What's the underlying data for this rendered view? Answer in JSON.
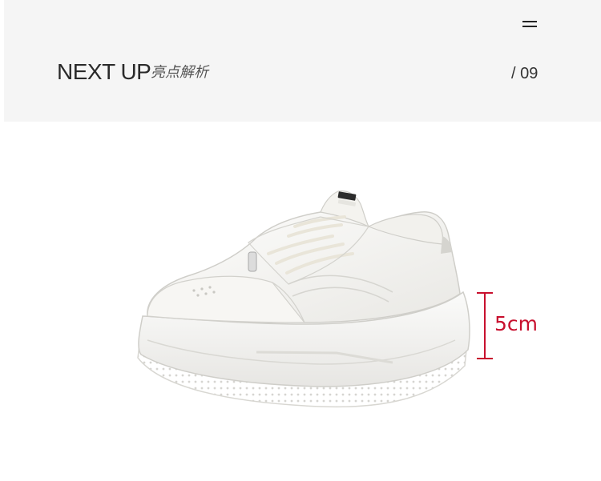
{
  "header": {
    "title": "NEXT UP",
    "subtitle": "亮点解析",
    "page_index": "/ 09",
    "menu_icon": "menu-icon"
  },
  "product": {
    "image": "white-platform-sneaker"
  },
  "measurement": {
    "label": "5cm",
    "color": "#c8102e"
  }
}
